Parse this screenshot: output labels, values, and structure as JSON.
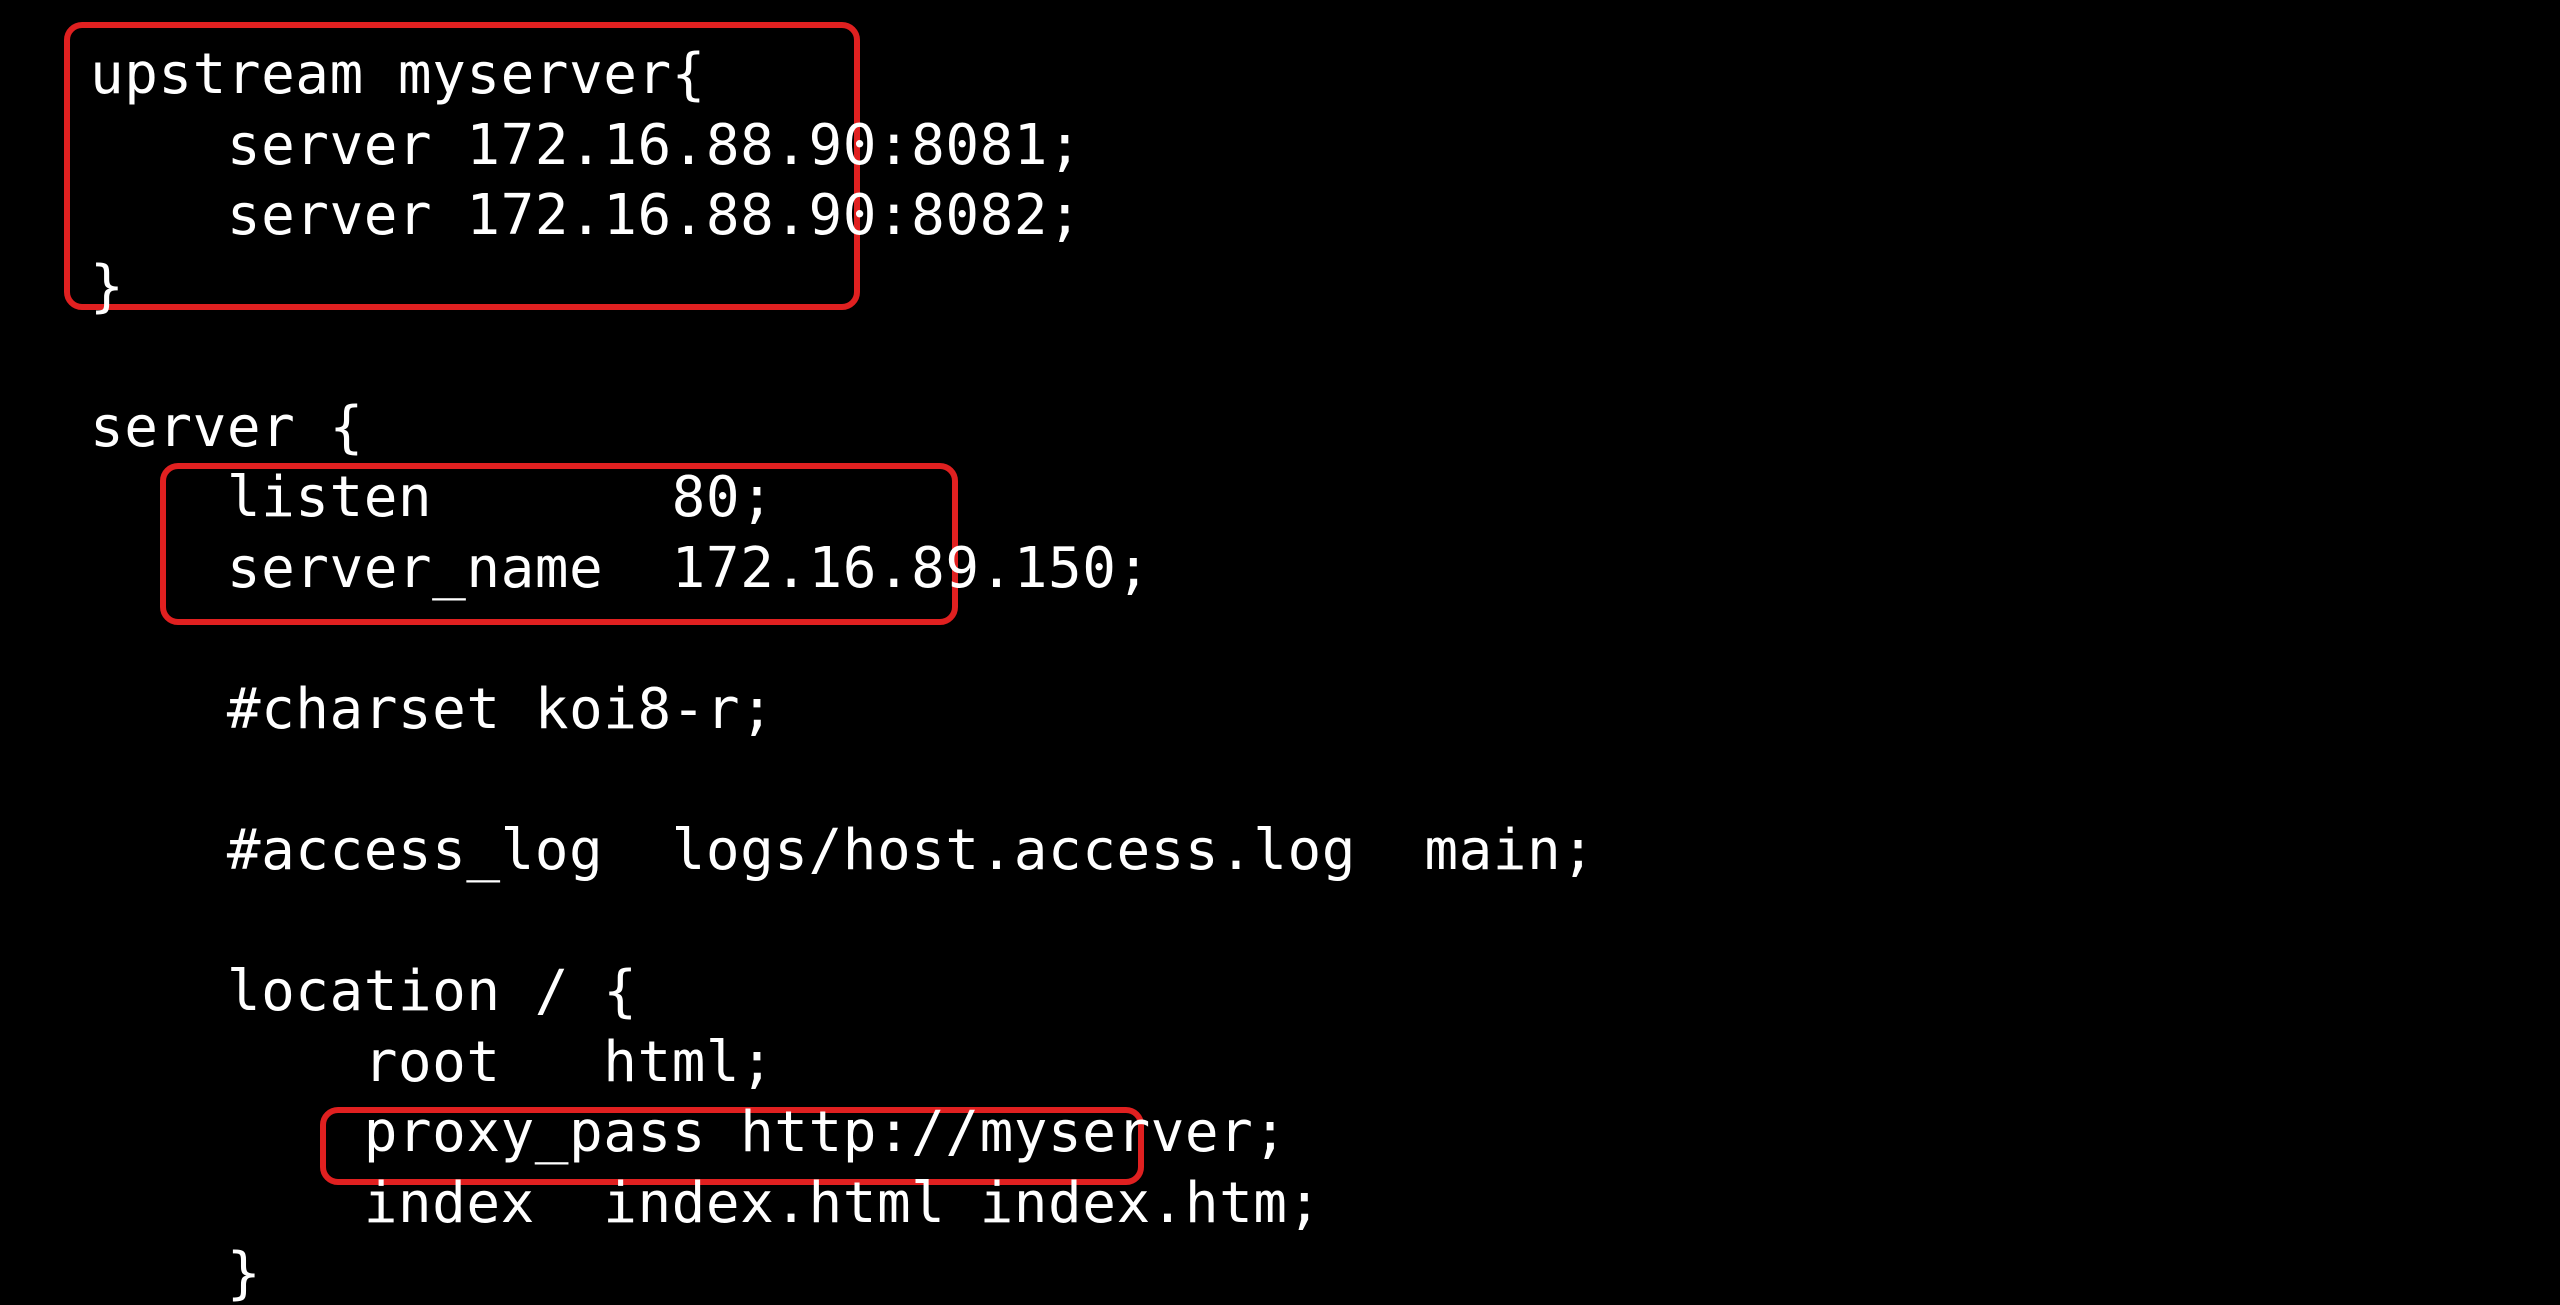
{
  "code": {
    "l01": "upstream myserver{",
    "l02": "    server 172.16.88.90:8081;",
    "l03": "    server 172.16.88.90:8082;",
    "l04": "}",
    "l05": "",
    "l06": "server {",
    "l07": "    listen       80;",
    "l08": "    server_name  172.16.89.150;",
    "l09": "",
    "l10": "    #charset koi8-r;",
    "l11": "",
    "l12": "    #access_log  logs/host.access.log  main;",
    "l13": "",
    "l14": "    location / {",
    "l15": "        root   html;",
    "l16": "        proxy_pass http://myserver;",
    "l17": "        index  index.html index.htm;",
    "l18": "    }"
  }
}
